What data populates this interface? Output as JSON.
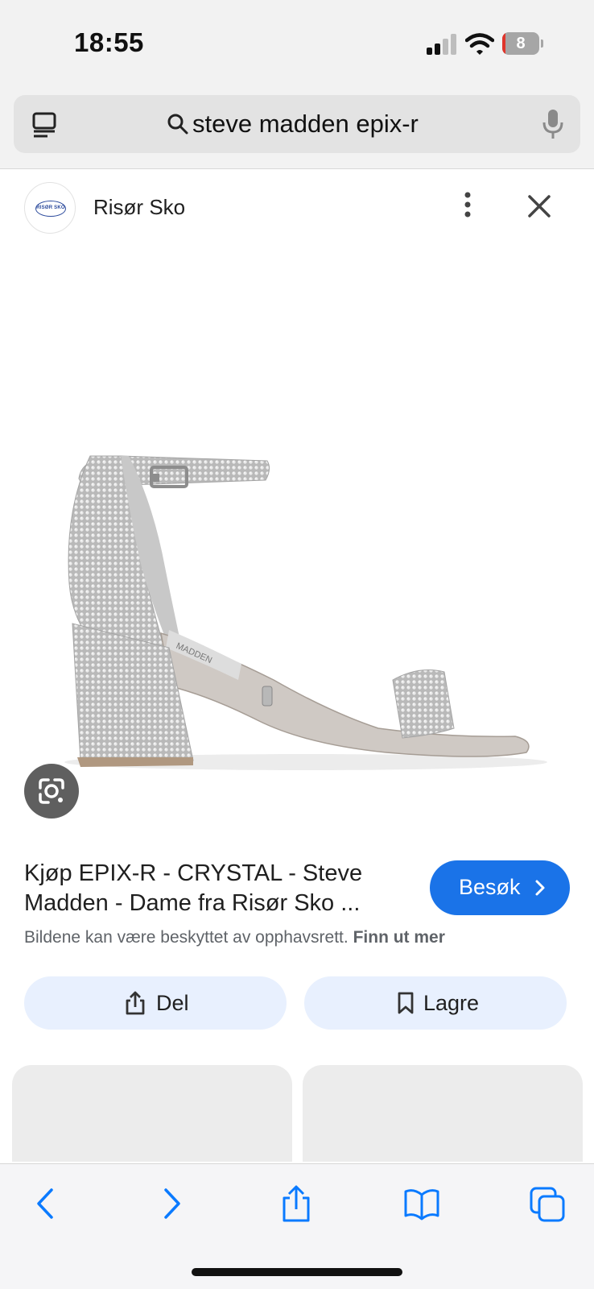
{
  "status_bar": {
    "time": "18:55",
    "battery_level": "8",
    "battery_fraction": 0.08
  },
  "url_bar": {
    "query": "steve madden epix-r"
  },
  "source": {
    "name": "Risør Sko",
    "logo_text": "RISØR SKO"
  },
  "product": {
    "title": "Kjøp EPIX-R - CRYSTAL - Steve Madden - Dame fra Risør Sko ...",
    "visit_label": "Besøk",
    "copyright_notice": "Bildene kan være beskyttet av opphavsrett.",
    "learn_more": "Finn ut mer",
    "shoe_brand_text": "MADDEN"
  },
  "actions": {
    "share_label": "Del",
    "save_label": "Lagre"
  },
  "colors": {
    "accent": "#1a73e8",
    "action_bg": "#e8f0fe",
    "safari_blue": "#0a7aff"
  },
  "icons": {
    "reader": "reader-icon",
    "search": "search-icon",
    "mic": "mic-icon",
    "more": "more-vertical-icon",
    "close": "close-icon",
    "lens": "google-lens-icon",
    "share": "share-icon",
    "bookmark": "bookmark-icon",
    "back": "back-icon",
    "forward": "forward-icon",
    "safari_share": "share-icon",
    "bookmarks": "book-icon",
    "tabs": "tabs-icon"
  }
}
